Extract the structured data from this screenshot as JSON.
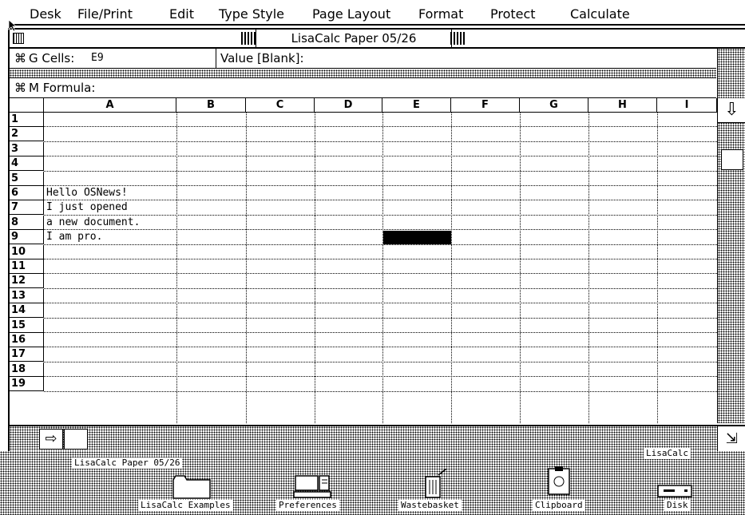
{
  "menubar": {
    "items": [
      "Desk",
      "File/Print",
      "Edit",
      "Type Style",
      "Page Layout",
      "Format",
      "Protect",
      "Calculate"
    ]
  },
  "window": {
    "title": "LisaCalc Paper 05/26"
  },
  "info": {
    "g_cells_label": "G Cells:",
    "g_cells_value": "E9",
    "value_label": "Value [Blank]:",
    "formula_label": "M Formula:",
    "apple_glyph": "⌘"
  },
  "columns": [
    "A",
    "B",
    "C",
    "D",
    "E",
    "F",
    "G",
    "H",
    "I"
  ],
  "rows": [
    "1",
    "2",
    "3",
    "4",
    "5",
    "6",
    "7",
    "8",
    "9",
    "10",
    "11",
    "12",
    "13",
    "14",
    "15",
    "16",
    "17",
    "18",
    "19"
  ],
  "cells": [
    {
      "row": "6",
      "text": "Hello OSNews!"
    },
    {
      "row": "7",
      "text": "I just opened"
    },
    {
      "row": "8",
      "text": "a new document."
    },
    {
      "row": "9",
      "text": "I am pro."
    }
  ],
  "selected_cell": "E9",
  "desktop": {
    "items": [
      {
        "label": "LisaCalc Paper 05/26",
        "icon": "document-icon"
      },
      {
        "label": "LisaCalc Examples",
        "icon": "folder-icon"
      },
      {
        "label": "Preferences",
        "icon": "computer-icon"
      },
      {
        "label": "Wastebasket",
        "icon": "wastebasket-icon"
      },
      {
        "label": "Clipboard",
        "icon": "clipboard-icon"
      },
      {
        "label": "Disk",
        "icon": "disk-icon"
      }
    ],
    "partial_label": "LisaCalc"
  }
}
